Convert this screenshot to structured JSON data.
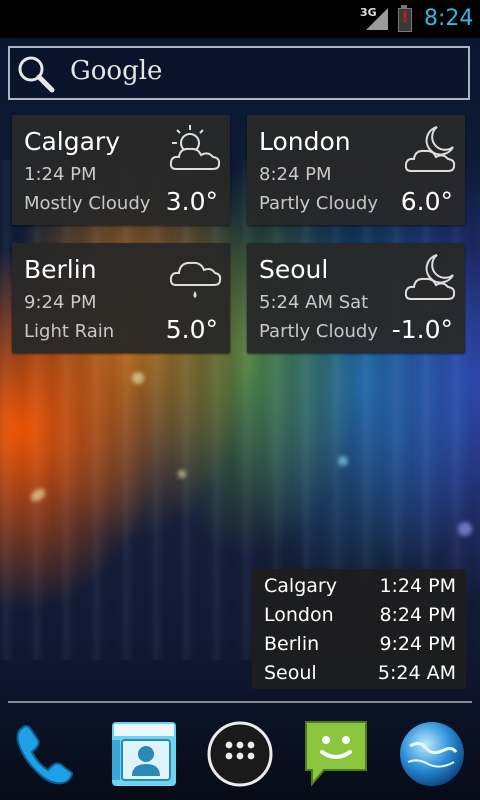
{
  "status_bar": {
    "network": "3G",
    "time": "8:24"
  },
  "search": {
    "label": "Google"
  },
  "weather_cards": [
    {
      "city": "Calgary",
      "time": "1:24 PM",
      "condition": "Mostly Cloudy",
      "temp": "3.0°",
      "icon": "sun-cloud-icon"
    },
    {
      "city": "London",
      "time": "8:24 PM",
      "condition": "Partly Cloudy",
      "temp": "6.0°",
      "icon": "moon-cloud-icon"
    },
    {
      "city": "Berlin",
      "time": "9:24 PM",
      "condition": "Light Rain",
      "temp": "5.0°",
      "icon": "rain-cloud-icon"
    },
    {
      "city": "Seoul",
      "time": "5:24 AM Sat",
      "condition": "Partly Cloudy",
      "temp": "-1.0°",
      "icon": "moon-cloud-icon"
    }
  ],
  "clock_list": [
    {
      "city": "Calgary",
      "time": "1:24 PM"
    },
    {
      "city": "London",
      "time": "8:24 PM"
    },
    {
      "city": "Berlin",
      "time": "9:24 PM"
    },
    {
      "city": "Seoul",
      "time": "5:24 AM"
    }
  ],
  "dock": [
    {
      "name": "phone-icon"
    },
    {
      "name": "contacts-icon"
    },
    {
      "name": "app-drawer-icon"
    },
    {
      "name": "messaging-icon"
    },
    {
      "name": "browser-icon"
    }
  ],
  "colors": {
    "clock": "#33b5e5",
    "card_bg": "#282828",
    "battery_alert": "#e01010"
  }
}
